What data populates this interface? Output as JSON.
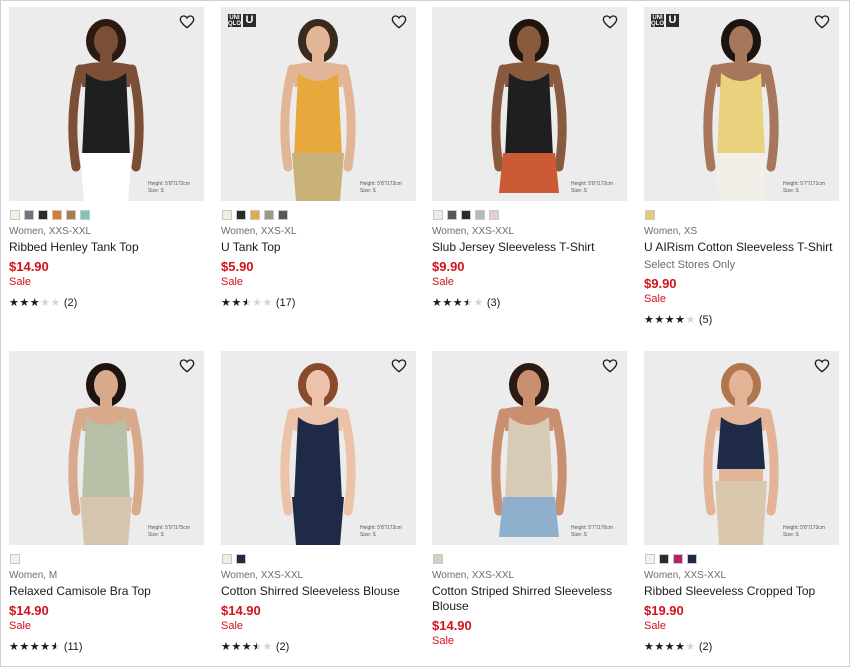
{
  "brand_badge": {
    "logo_text": "UNI QLO",
    "letter": "U"
  },
  "products": [
    {
      "meta": "Women, XXS-XXL",
      "name": "Ribbed Henley Tank Top",
      "price": "$14.90",
      "sale_label": "Sale",
      "stores_note": "",
      "rating": 3,
      "reviews": "(2)",
      "badge": false,
      "height_note": "Height: 5'8\"/172cm Size: S",
      "swatches": [
        "#f4efe2",
        "#6f7479",
        "#2a2a2a",
        "#d97a30",
        "#a77c52",
        "#7ec6b8"
      ],
      "colors": {
        "bg": "#ececec",
        "top": "#1f1f1f",
        "bottom": "#ffffff",
        "skin": "#7b4f36",
        "hair": "#2a1a12"
      }
    },
    {
      "meta": "Women, XXS-XL",
      "name": "U Tank Top",
      "price": "$5.90",
      "sale_label": "Sale",
      "stores_note": "",
      "rating": 2.5,
      "reviews": "(17)",
      "badge": true,
      "height_note": "Height: 5'8\"/173cm Size: S",
      "swatches": [
        "#f1ece0",
        "#2a2a2a",
        "#e2a84a",
        "#9c9a80",
        "#55585c"
      ],
      "colors": {
        "bg": "#ececec",
        "top": "#e8a93c",
        "bottom": "#c9b27a",
        "skin": "#e2b597",
        "hair": "#3a2a1e"
      }
    },
    {
      "meta": "Women, XXS-XXL",
      "name": "Slub Jersey Sleeveless T-Shirt",
      "price": "$9.90",
      "sale_label": "Sale",
      "stores_note": "",
      "rating": 3.5,
      "reviews": "(3)",
      "badge": false,
      "height_note": "Height: 5'8\"/172cm Size: S",
      "swatches": [
        "#efece6",
        "#55585c",
        "#2a2a2a",
        "#b3bcb1",
        "#e6ccd5"
      ],
      "colors": {
        "bg": "#ececec",
        "top": "#1f1f1f",
        "bottom": "#cc5b35",
        "skin": "#8a5a3f",
        "hair": "#1f150f"
      }
    },
    {
      "meta": "Women, XS",
      "name": "U AIRism Cotton Sleeveless T-Shirt",
      "price": "$9.90",
      "sale_label": "Sale",
      "stores_note": "Select Stores Only",
      "rating": 4,
      "reviews": "(5)",
      "badge": true,
      "height_note": "Height: 5'7\"/171cm Size: S",
      "swatches": [
        "#e7c77c"
      ],
      "colors": {
        "bg": "#ececec",
        "top": "#e8d27e",
        "bottom": "#f2efe8",
        "skin": "#a8765a",
        "hair": "#1c1410"
      }
    },
    {
      "meta": "Women, M",
      "name": "Relaxed Camisole Bra Top",
      "price": "$14.90",
      "sale_label": "Sale",
      "stores_note": "",
      "rating": 4.5,
      "reviews": "(11)",
      "badge": false,
      "height_note": "Height: 5'9\"/175cm Size: S",
      "swatches": [
        "#f3f1ec"
      ],
      "colors": {
        "bg": "#ececec",
        "top": "#b7c0a6",
        "bottom": "#d6c5ae",
        "skin": "#d9a98c",
        "hair": "#1e140f"
      }
    },
    {
      "meta": "Women, XXS-XXL",
      "name": "Cotton Shirred Sleeveless Blouse",
      "price": "$14.90",
      "sale_label": "Sale",
      "stores_note": "",
      "rating": 3.5,
      "reviews": "(2)",
      "badge": false,
      "height_note": "Height: 5'8\"/173cm Size: S",
      "swatches": [
        "#efece6",
        "#1f2a44"
      ],
      "colors": {
        "bg": "#ececec",
        "top": "#1e2a48",
        "bottom": "#1e2a48",
        "skin": "#ecc3a8",
        "hair": "#8a4b2c"
      }
    },
    {
      "meta": "Women, XXS-XXL",
      "name": "Cotton Striped Shirred Sleeveless Blouse",
      "price": "$14.90",
      "sale_label": "Sale",
      "stores_note": "",
      "rating": 0,
      "reviews": "",
      "badge": false,
      "height_note": "Height: 5'7\"/170cm Size: S",
      "swatches": [
        "#d9cfc2"
      ],
      "colors": {
        "bg": "#ececec",
        "top": "#d8cbb6",
        "bottom": "#8fb0cc",
        "skin": "#c98f6e",
        "hair": "#2a1a12"
      }
    },
    {
      "meta": "Women, XXS-XXL",
      "name": "Ribbed Sleeveless Cropped Top",
      "price": "$19.90",
      "sale_label": "Sale",
      "stores_note": "",
      "rating": 4,
      "reviews": "(2)",
      "badge": false,
      "height_note": "Height: 5'8\"/173cm Size: S",
      "swatches": [
        "#f3f1ec",
        "#2a2a2a",
        "#b51f6b",
        "#1f2a44"
      ],
      "colors": {
        "bg": "#ececec",
        "top": "#1f2a48",
        "bottom": "#d9c8ae",
        "skin": "#e3b497",
        "hair": "#b0774e"
      }
    }
  ]
}
